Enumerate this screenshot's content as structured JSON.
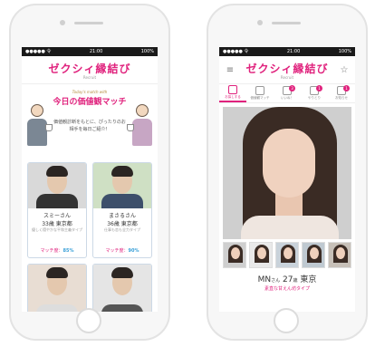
{
  "status": {
    "carrier": "●●●●● 令",
    "time": "21:00",
    "battery": "100%"
  },
  "brand": {
    "logo": "ゼクシィ縁結び",
    "sub": "Recruit"
  },
  "left": {
    "hero_mini": "Today's match with",
    "hero_title": "今日の価値観マッチ",
    "hero_desc": "価値観診断をもとに、ぴったりのお相手を毎日ご紹介！",
    "cards": [
      {
        "name": "スミーさん",
        "age": "33歳 東京都",
        "type": "優しく穏やかな平和主義タイプ",
        "match_label": "マッチ度：",
        "match_value": "85%"
      },
      {
        "name": "まさるさん",
        "age": "36歳 東京都",
        "type": "仕事も恋も全力タイプ",
        "match_label": "マッチ度：",
        "match_value": "90%"
      }
    ]
  },
  "right": {
    "tabs": [
      {
        "label": "お探しする",
        "badge": ""
      },
      {
        "label": "価値観マッチ",
        "badge": ""
      },
      {
        "label": "いいね！",
        "badge": "3"
      },
      {
        "label": "やりとり",
        "badge": "1"
      },
      {
        "label": "お知らせ",
        "badge": "1"
      }
    ],
    "profile_name": "MN",
    "profile_san": "さん",
    "profile_age": "27",
    "profile_age_unit": "歳",
    "profile_city": "東京",
    "profile_type": "素直な甘えん坊タイプ"
  },
  "colors": {
    "accent": "#e0227d",
    "match_blue": "#3aa0d8"
  }
}
